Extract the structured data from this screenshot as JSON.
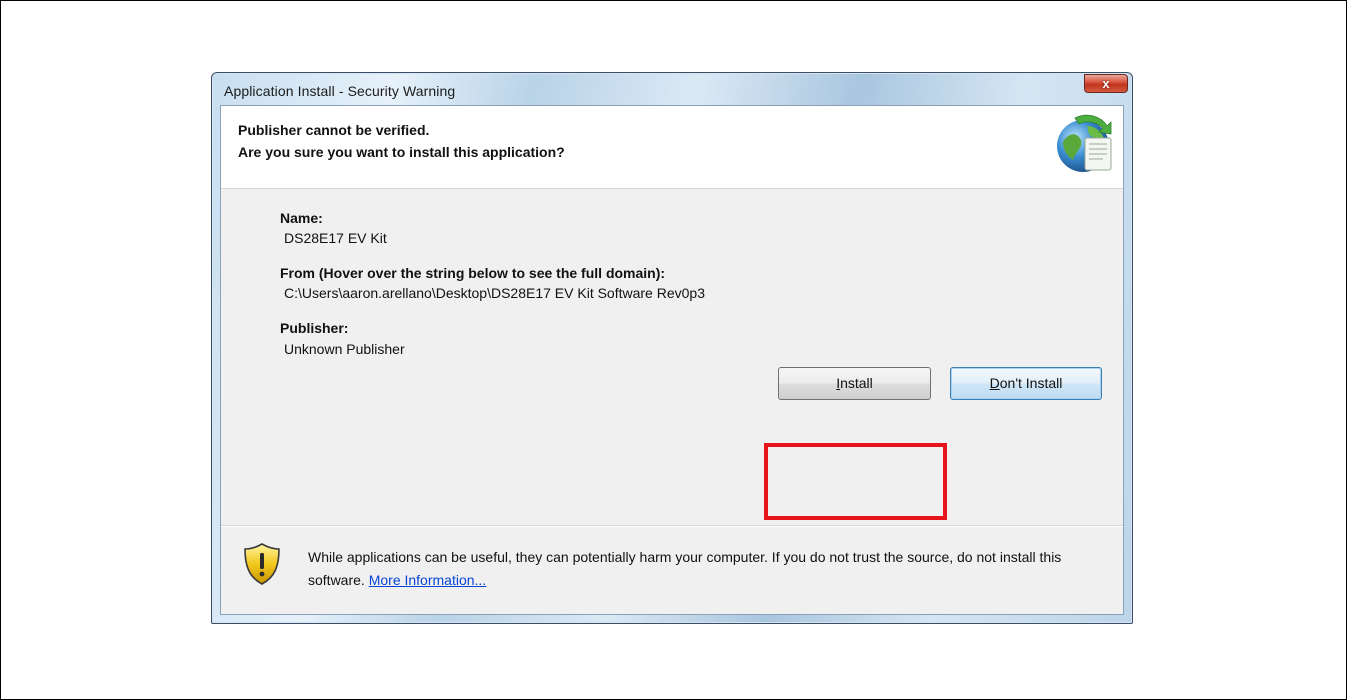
{
  "window": {
    "title": "Application Install - Security Warning",
    "close_label": "x"
  },
  "header": {
    "line1": "Publisher cannot be verified.",
    "line2": "Are you sure you want to install this application?",
    "icon": "globe-install-icon"
  },
  "fields": {
    "name_label": "Name:",
    "name_value": "DS28E17 EV Kit",
    "from_label": "From (Hover over the string below to see the full domain):",
    "from_value": "C:\\Users\\aaron.arellano\\Desktop\\DS28E17 EV Kit Software Rev0p3",
    "publisher_label": "Publisher:",
    "publisher_value": "Unknown Publisher"
  },
  "buttons": {
    "install_label": "Install",
    "install_accel": "I",
    "install_rest": "nstall",
    "dont_install_label": "Don't Install",
    "dont_install_accel": "D",
    "dont_install_rest": "on't Install"
  },
  "footer": {
    "warning_text": "While applications can be useful, they can potentially harm your computer. If you do not trust the source, do not install this software.",
    "link_text": "More Information...",
    "icon": "security-shield-icon"
  },
  "colors": {
    "highlight": "#e8141b",
    "link": "#0645d6",
    "close_button": "#c2351e"
  }
}
